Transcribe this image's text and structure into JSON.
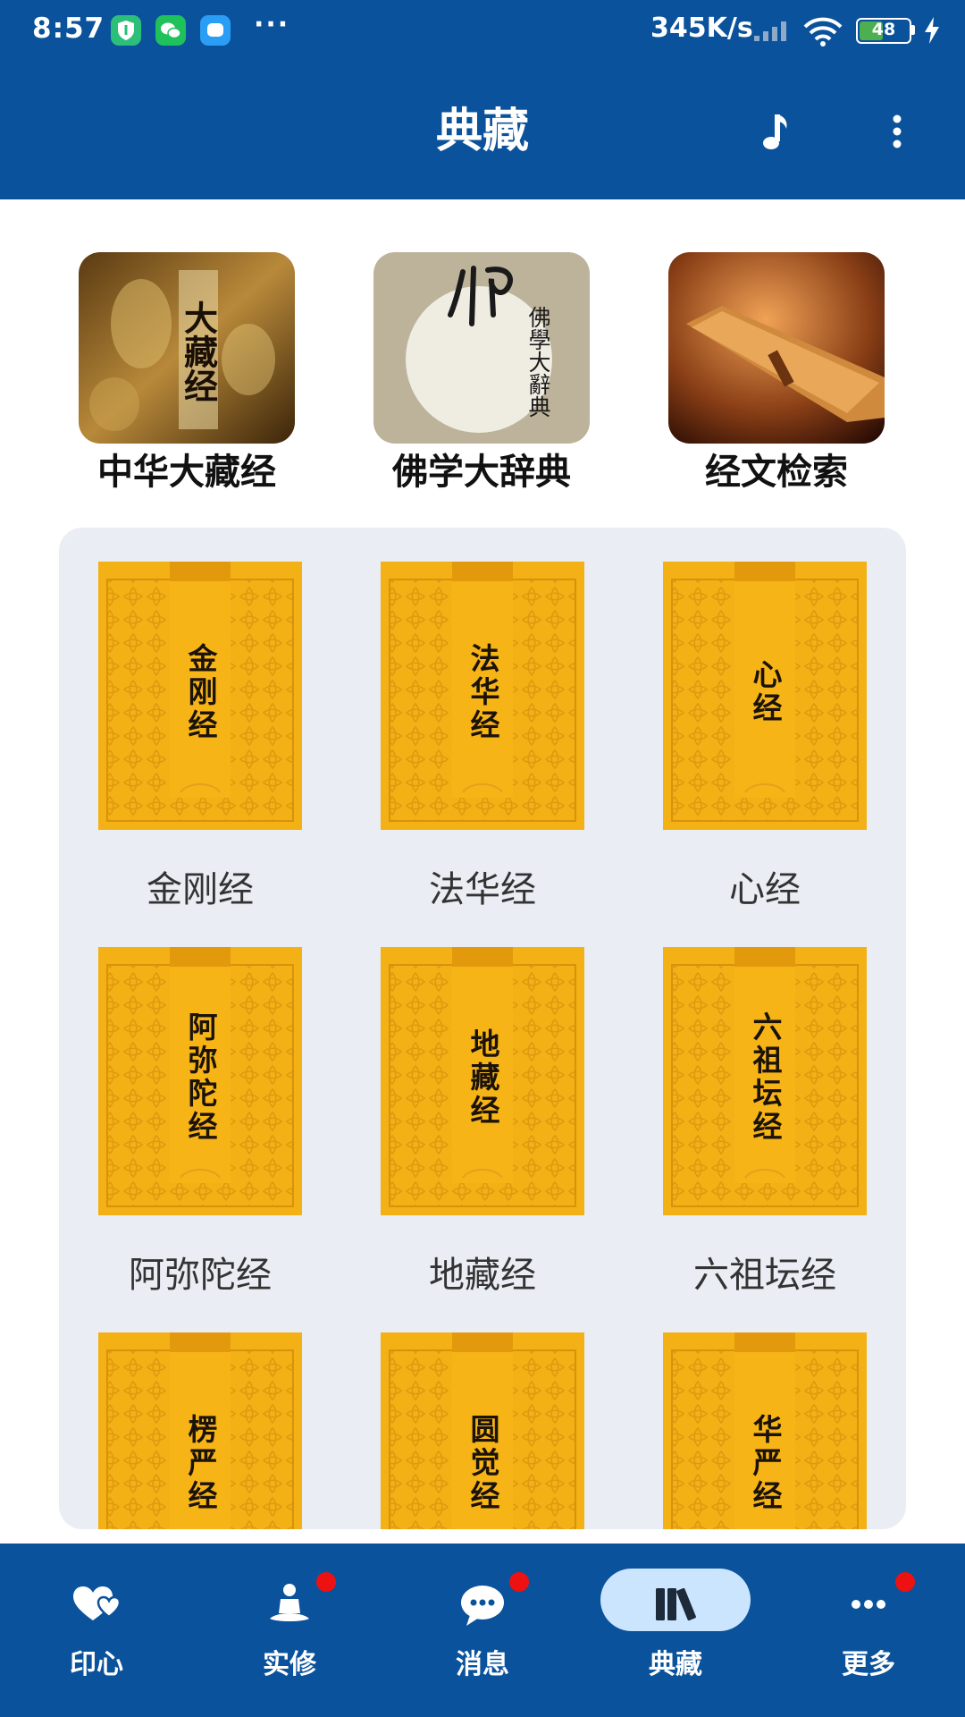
{
  "status_bar": {
    "time": "8:57",
    "network_speed": "345K/s",
    "battery_level": "48",
    "overflow": "···"
  },
  "app_bar": {
    "title": "典藏"
  },
  "featured": [
    {
      "label": "中华大藏经",
      "cover_text": "大藏经"
    },
    {
      "label": "佛学大辞典",
      "cover_text": "佛學大辭典"
    },
    {
      "label": "经文检索"
    }
  ],
  "sutras": [
    {
      "label": "金刚经",
      "cover": "金刚经"
    },
    {
      "label": "法华经",
      "cover": "法华经"
    },
    {
      "label": "心经",
      "cover": "心经"
    },
    {
      "label": "阿弥陀经",
      "cover": "阿弥陀经"
    },
    {
      "label": "地藏经",
      "cover": "地藏经"
    },
    {
      "label": "六祖坛经",
      "cover": "六祖坛经"
    },
    {
      "label": "",
      "cover": "楞严经"
    },
    {
      "label": "",
      "cover": "圆觉经"
    },
    {
      "label": "",
      "cover": "华严经"
    }
  ],
  "bottom_nav": [
    {
      "label": "印心",
      "icon": "heart-icon",
      "badge": false,
      "active": false
    },
    {
      "label": "实修",
      "icon": "meditation-icon",
      "badge": true,
      "active": false
    },
    {
      "label": "消息",
      "icon": "chat-icon",
      "badge": true,
      "active": false
    },
    {
      "label": "典藏",
      "icon": "books-icon",
      "badge": false,
      "active": true
    },
    {
      "label": "更多",
      "icon": "more-dots-icon",
      "badge": true,
      "active": false
    }
  ],
  "colors": {
    "primary": "#0a529b",
    "panel_bg": "#eaeef4",
    "cover_gold": "#f3b116",
    "badge_red": "#ee1111",
    "active_pill": "#cce5ff"
  }
}
